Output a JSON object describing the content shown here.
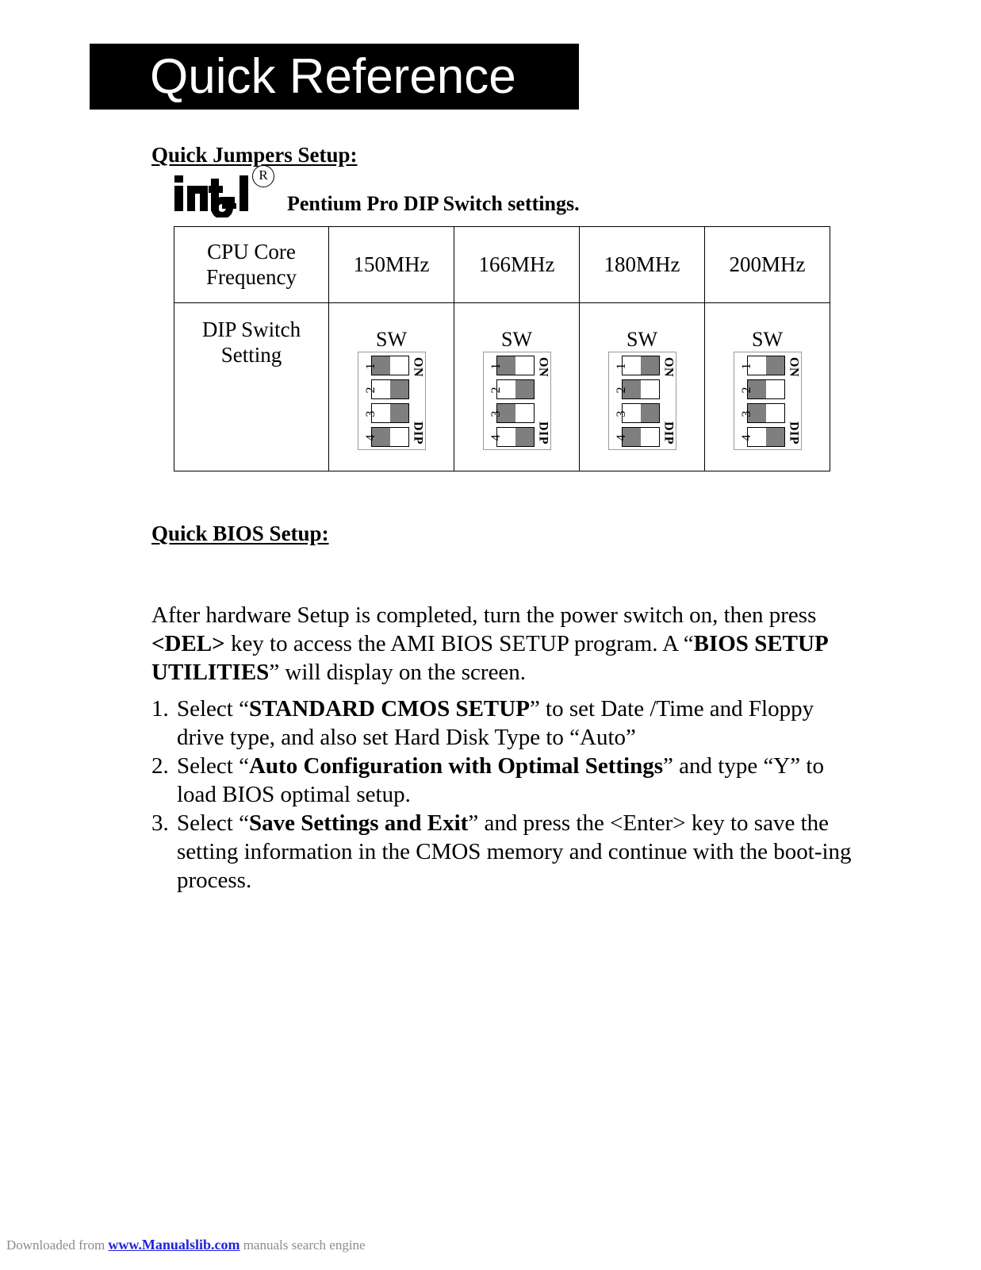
{
  "page": {
    "title_banner": "Quick Reference"
  },
  "jumpers": {
    "heading": "Quick Jumpers Setup:",
    "logo_alt": "intel-logo",
    "registered_symbol": "R",
    "caption": "Pentium Pro DIP Switch settings."
  },
  "dip_table": {
    "row_labels": [
      "CPU Core Frequency",
      "DIP Switch Setting"
    ],
    "frequencies": [
      "150MHz",
      "166MHz",
      "180MHz",
      "200MHz"
    ],
    "sw_label": "SW",
    "side_labels": {
      "top": "ON",
      "bottom": "DIP"
    },
    "switch_numbers": [
      "1",
      "2",
      "3",
      "4"
    ],
    "settings": [
      {
        "frequency": "150MHz",
        "positions": [
          "left",
          "right",
          "right",
          "left"
        ]
      },
      {
        "frequency": "166MHz",
        "positions": [
          "left",
          "right",
          "left",
          "right"
        ]
      },
      {
        "frequency": "180MHz",
        "positions": [
          "right",
          "left",
          "right",
          "left"
        ]
      },
      {
        "frequency": "200MHz",
        "positions": [
          "right",
          "left",
          "left",
          "right"
        ]
      }
    ]
  },
  "bios": {
    "heading": "Quick BIOS Setup:",
    "intro": {
      "part1": "After hardware Setup is completed, turn the power switch on, then press ",
      "bold1": "<DEL>",
      "part2": " key to access the AMI BIOS SETUP program. A “",
      "bold2": "BIOS SETUP UTILITIES",
      "part3": "” will display on the screen."
    },
    "steps": [
      {
        "num": "1.",
        "pre": "Select “",
        "bold": "STANDARD CMOS SETUP",
        "post": "” to set Date /Time and Floppy drive type, and also set Hard Disk Type to “Auto”"
      },
      {
        "num": "2.",
        "pre": "Select “",
        "bold": "Auto Configuration with Optimal Settings",
        "post": "” and type “Y” to load BIOS optimal setup."
      },
      {
        "num": "3.",
        "pre": "Select “",
        "bold": "Save Settings and Exit",
        "post": "” and press the <Enter> key to save the setting information in the CMOS memory and continue with the boot-ing process."
      }
    ]
  },
  "footer": {
    "prefix": "Downloaded from ",
    "link": "www.Manualslib.com",
    "suffix": " manuals search engine"
  },
  "colors": {
    "banner_bg": "#000000",
    "banner_text": "#ffffff",
    "switch_on": "#7f7f7f",
    "link": "#2222dd",
    "footer_text": "#8c8c8c"
  }
}
